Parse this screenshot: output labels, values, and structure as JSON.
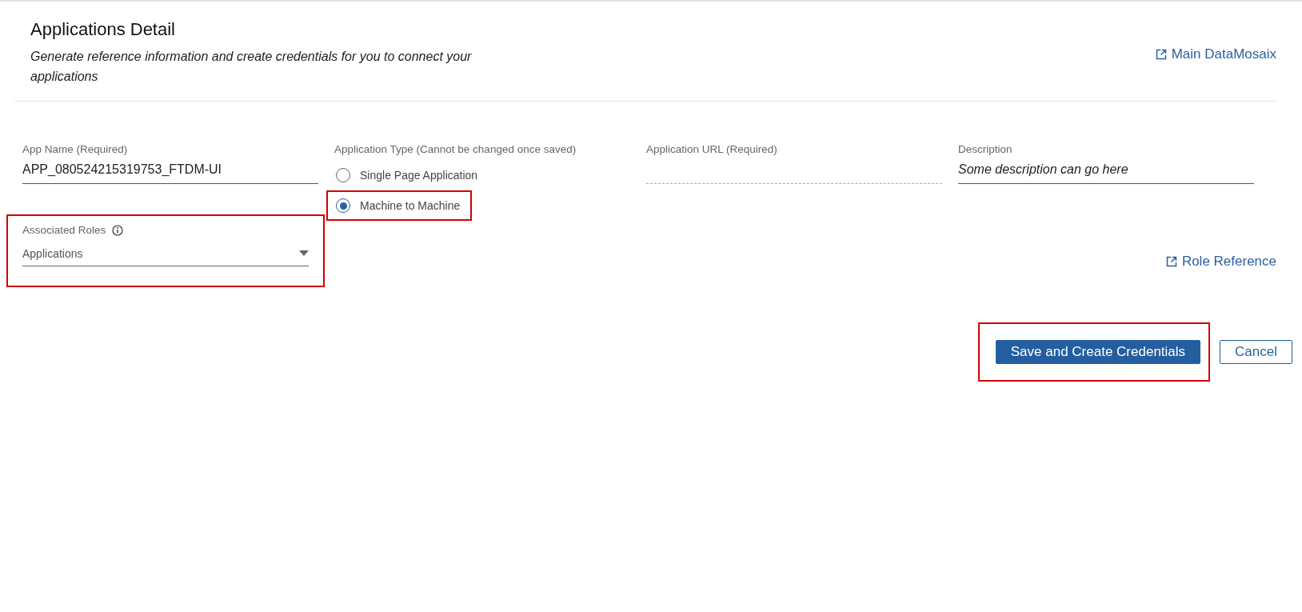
{
  "header": {
    "title": "Applications Detail",
    "subtitle": "Generate reference information and create credentials for you to connect your applications",
    "link": "Main DataMosaix"
  },
  "fields": [
    {
      "kind": "text",
      "label": "App Name (Required)",
      "value": "APP_080524215319753_FTDM-UI"
    },
    {
      "kind": "radio",
      "label": "Application Type (Cannot be changed once saved)",
      "options": [
        {
          "label": "Single Page Application",
          "selected": false,
          "highlighted": false
        },
        {
          "label": "Machine to Machine",
          "selected": true,
          "highlighted": true
        }
      ]
    },
    {
      "kind": "url",
      "label": "Application URL (Required)"
    },
    {
      "kind": "italic",
      "label": "Description",
      "value": "Some description can go here"
    }
  ],
  "roles": {
    "label": "Associated Roles",
    "value": "Applications",
    "highlighted": true
  },
  "role_link": "Role Reference",
  "buttons": [
    {
      "kind": "primary",
      "label": "Save and Create Credentials",
      "highlighted": true
    },
    {
      "kind": "secondary",
      "label": "Cancel",
      "highlighted": false
    }
  ]
}
